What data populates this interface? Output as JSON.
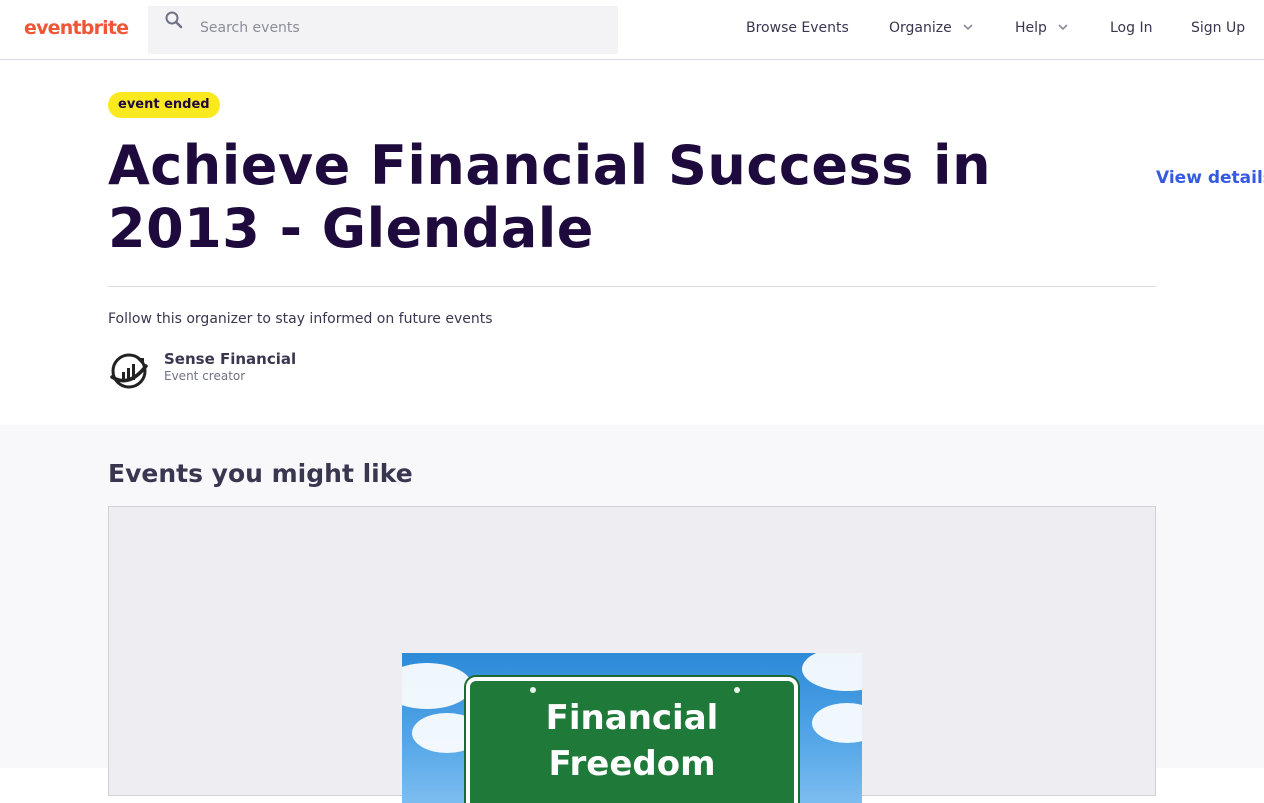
{
  "header": {
    "logo": "eventbrite",
    "search_placeholder": "Search events",
    "nav": {
      "browse": "Browse Events",
      "organize": "Organize",
      "help": "Help",
      "login": "Log In",
      "signup": "Sign Up"
    }
  },
  "event": {
    "status_badge": "event ended",
    "title": "Achieve Financial Success in 2013 - Glendale",
    "view_details": "View details",
    "follow_text": "Follow this organizer to stay informed on future events",
    "organizer": {
      "name": "Sense Financial",
      "role": "Event creator"
    }
  },
  "related": {
    "title": "Events you might like",
    "card_image_text": [
      "Financial",
      "Freedom"
    ]
  },
  "colors": {
    "brand": "#f05537",
    "title": "#1e0a3c",
    "link": "#3659e3",
    "badge": "#fbe920"
  },
  "icons": {
    "search": "search-icon",
    "chevron": "chevron-down-icon",
    "avatar": "sense-financial-logo-icon"
  }
}
